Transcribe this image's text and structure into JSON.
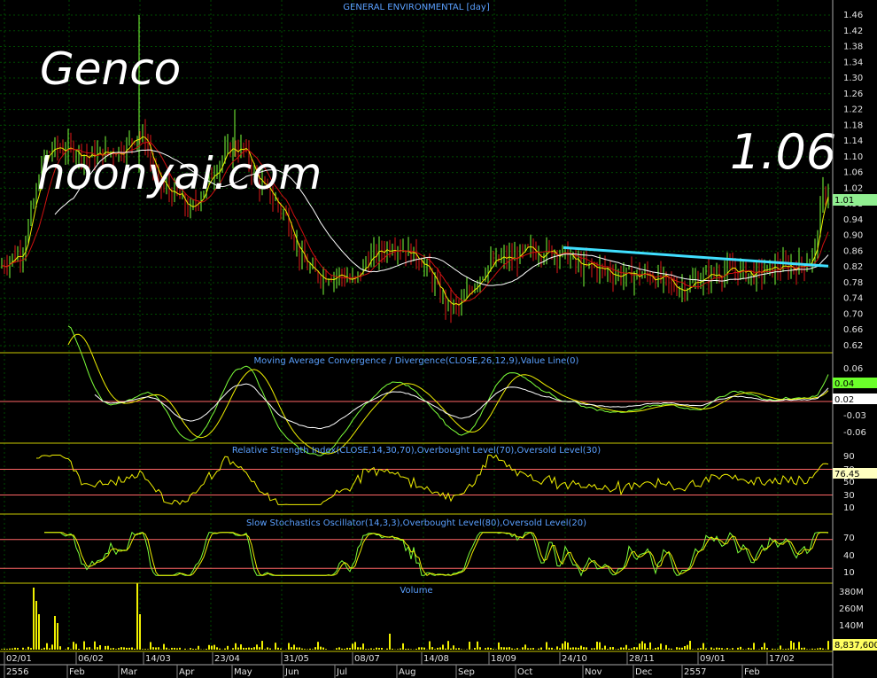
{
  "title": "GENERAL ENVIRONMENTAL [day]",
  "overlay": {
    "name": "Genco",
    "site": "hoonyai.com",
    "price": "1.06"
  },
  "panels": {
    "macd": "Moving Average Convergence / Divergence(CLOSE,26,12,9),Value Line(0)",
    "rsi": "Relative Strength Index(CLOSE,14,30,70),Overbought Level(70),Oversold Level(30)",
    "stoch": "Slow Stochastics Oscillator(14,3,3),Overbought Level(80),Oversold Level(20)",
    "volume": "Volume"
  },
  "markers": {
    "price": "1.01",
    "macd1": "0.04",
    "macd2": "0.02",
    "rsi": "76.45",
    "volume": "8,837,600"
  },
  "colors": {
    "up": "#7dff3a",
    "down": "#e01818",
    "grid": "#004a00",
    "sep": "#c8c800",
    "ma_white": "#ffffff",
    "ma_yellow": "#f0f000",
    "ma_red": "#d01010",
    "trend": "#40e0ff",
    "axis_text": "#e0e0e0",
    "panel_title": "#5aa0ff"
  },
  "chart_data": {
    "type": "line",
    "title": "GENERAL ENVIRONMENTAL [day]",
    "price_axis": {
      "ticks": [
        "1.46",
        "1.42",
        "1.38",
        "1.34",
        "1.30",
        "1.26",
        "1.22",
        "1.18",
        "1.14",
        "1.10",
        "1.06",
        "1.02",
        "0.98",
        "0.94",
        "0.90",
        "0.86",
        "0.82",
        "0.78",
        "0.74",
        "0.70",
        "0.66",
        "0.62"
      ],
      "ylim": [
        0.6,
        1.48
      ]
    },
    "macd_axis": {
      "ticks": [
        "0.06",
        "0.02",
        "-0.03",
        "-0.06"
      ]
    },
    "rsi_axis": {
      "ticks": [
        "90",
        "70",
        "50",
        "30",
        "10"
      ]
    },
    "stoch_axis": {
      "ticks": [
        "70",
        "40",
        "10"
      ]
    },
    "volume_axis": {
      "ticks": [
        "380M",
        "260M",
        "140M"
      ]
    },
    "date_labels": [
      "02/01",
      "06/02",
      "14/03",
      "23/04",
      "31/05",
      "08/07",
      "14/08",
      "18/09",
      "24/10",
      "28/11",
      "09/01",
      "17/02"
    ],
    "month_labels": [
      "2556",
      "Feb",
      "Mar",
      "Apr",
      "May",
      "Jun",
      "Jul",
      "Aug",
      "Sep",
      "Oct",
      "Nov",
      "Dec",
      "2557",
      "Feb"
    ],
    "close_series": [
      {
        "x": 0,
        "y": 0.82
      },
      {
        "x": 10,
        "y": 0.84
      },
      {
        "x": 25,
        "y": 0.86
      },
      {
        "x": 40,
        "y": 1.0
      },
      {
        "x": 50,
        "y": 1.1
      },
      {
        "x": 60,
        "y": 1.12
      },
      {
        "x": 80,
        "y": 1.12
      },
      {
        "x": 100,
        "y": 1.1
      },
      {
        "x": 120,
        "y": 1.11
      },
      {
        "x": 140,
        "y": 1.12
      },
      {
        "x": 155,
        "y": 1.16
      },
      {
        "x": 165,
        "y": 1.14
      },
      {
        "x": 175,
        "y": 1.05
      },
      {
        "x": 185,
        "y": 1.02
      },
      {
        "x": 200,
        "y": 1.0
      },
      {
        "x": 215,
        "y": 0.96
      },
      {
        "x": 230,
        "y": 1.02
      },
      {
        "x": 245,
        "y": 1.08
      },
      {
        "x": 260,
        "y": 1.12
      },
      {
        "x": 275,
        "y": 1.12
      },
      {
        "x": 290,
        "y": 1.04
      },
      {
        "x": 310,
        "y": 0.99
      },
      {
        "x": 325,
        "y": 0.94
      },
      {
        "x": 340,
        "y": 0.84
      },
      {
        "x": 355,
        "y": 0.8
      },
      {
        "x": 370,
        "y": 0.8
      },
      {
        "x": 385,
        "y": 0.8
      },
      {
        "x": 400,
        "y": 0.78
      },
      {
        "x": 415,
        "y": 0.84
      },
      {
        "x": 430,
        "y": 0.86
      },
      {
        "x": 445,
        "y": 0.88
      },
      {
        "x": 460,
        "y": 0.86
      },
      {
        "x": 475,
        "y": 0.84
      },
      {
        "x": 490,
        "y": 0.78
      },
      {
        "x": 505,
        "y": 0.72
      },
      {
        "x": 520,
        "y": 0.72
      },
      {
        "x": 535,
        "y": 0.78
      },
      {
        "x": 550,
        "y": 0.82
      },
      {
        "x": 565,
        "y": 0.84
      },
      {
        "x": 580,
        "y": 0.84
      },
      {
        "x": 595,
        "y": 0.86
      },
      {
        "x": 610,
        "y": 0.86
      },
      {
        "x": 625,
        "y": 0.86
      },
      {
        "x": 640,
        "y": 0.85
      },
      {
        "x": 655,
        "y": 0.82
      },
      {
        "x": 670,
        "y": 0.82
      },
      {
        "x": 685,
        "y": 0.81
      },
      {
        "x": 700,
        "y": 0.8
      },
      {
        "x": 715,
        "y": 0.8
      },
      {
        "x": 730,
        "y": 0.8
      },
      {
        "x": 745,
        "y": 0.79
      },
      {
        "x": 760,
        "y": 0.77
      },
      {
        "x": 775,
        "y": 0.77
      },
      {
        "x": 790,
        "y": 0.79
      },
      {
        "x": 805,
        "y": 0.8
      },
      {
        "x": 820,
        "y": 0.81
      },
      {
        "x": 835,
        "y": 0.81
      },
      {
        "x": 850,
        "y": 0.8
      },
      {
        "x": 865,
        "y": 0.81
      },
      {
        "x": 880,
        "y": 0.82
      },
      {
        "x": 895,
        "y": 0.82
      },
      {
        "x": 910,
        "y": 0.83
      },
      {
        "x": 920,
        "y": 0.86
      },
      {
        "x": 928,
        "y": 1.0
      },
      {
        "x": 933,
        "y": 1.01
      }
    ]
  }
}
